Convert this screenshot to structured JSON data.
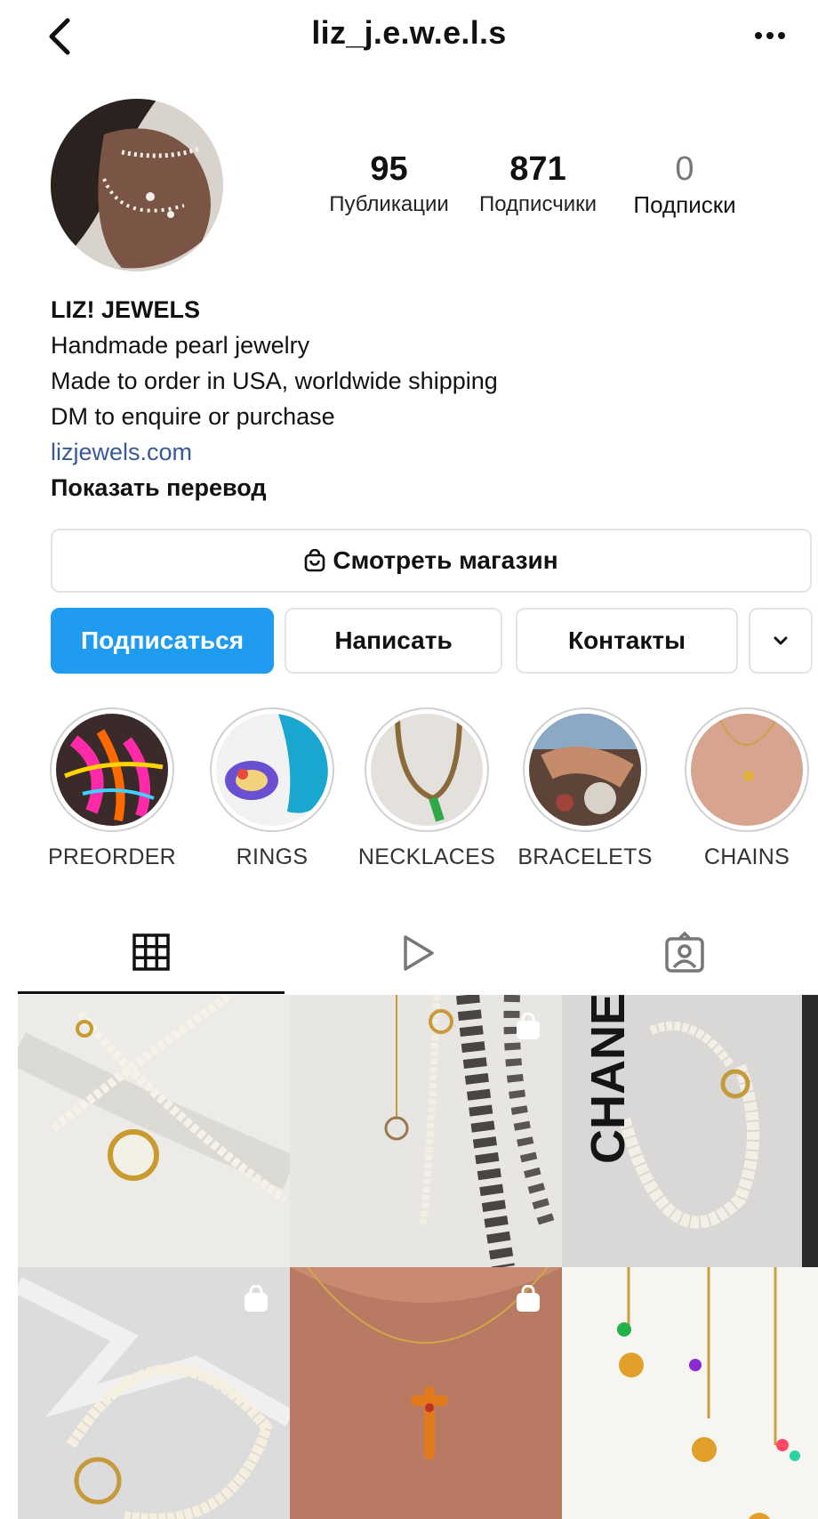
{
  "header": {
    "username": "liz_j.e.w.e.l.s",
    "back_icon": "chevron-left-icon",
    "more_icon": "ellipsis-icon"
  },
  "profile": {
    "stats": [
      {
        "value": "95",
        "label": "Публикации"
      },
      {
        "value": "871",
        "label": "Подписчики"
      },
      {
        "value": "0",
        "label": "Подписки"
      }
    ],
    "name": "LIZ! JEWELS",
    "bio_lines": [
      "Handmade pearl jewelry",
      "Made to order in USA, worldwide shipping",
      "DM to enquire or purchase"
    ],
    "link": "lizjewels.com",
    "translate": "Показать перевод"
  },
  "actions": {
    "shop_label": "Смотреть магазин",
    "follow_label": "Подписаться",
    "message_label": "Написать",
    "contacts_label": "Контакты"
  },
  "highlights": [
    {
      "label": "PREORDER"
    },
    {
      "label": "RINGS"
    },
    {
      "label": "NECKLACES"
    },
    {
      "label": "BRACELETS"
    },
    {
      "label": "CHAINS"
    }
  ],
  "tabs": [
    {
      "name": "grid",
      "icon": "grid-icon",
      "active": true
    },
    {
      "name": "reels",
      "icon": "play-icon",
      "active": false
    },
    {
      "name": "tagged",
      "icon": "tagged-person-icon",
      "active": false
    }
  ],
  "posts": {
    "post3_text": "CHANEL"
  },
  "colors": {
    "accent": "#1f9bf0",
    "link": "#385898"
  }
}
